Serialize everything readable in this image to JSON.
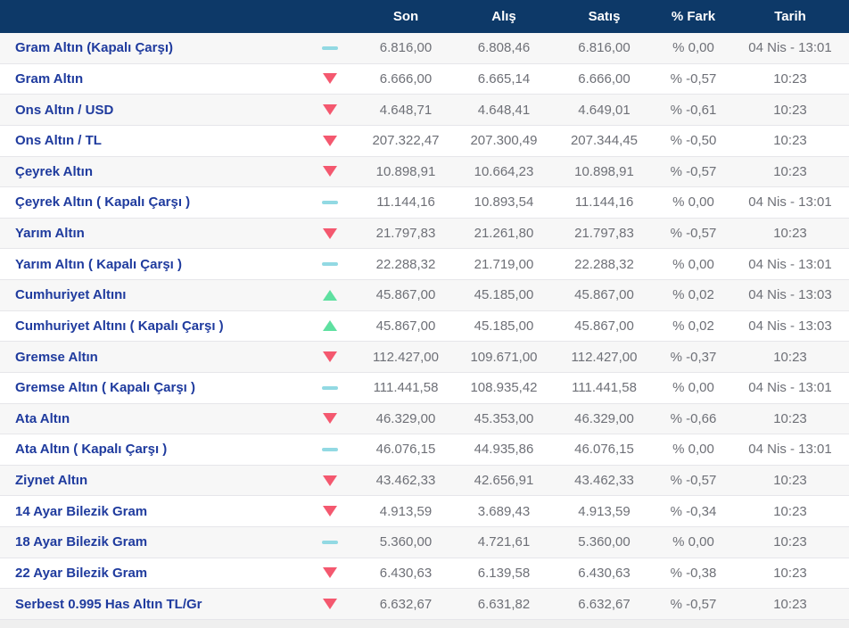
{
  "table": {
    "columns": [
      "Son",
      "Alış",
      "Satış",
      "% Fark",
      "Tarih"
    ],
    "rows": [
      {
        "name": "Gram Altın (Kapalı Çarşı)",
        "trend": "flat",
        "son": "6.816,00",
        "alis": "6.808,46",
        "satis": "6.816,00",
        "fark": "% 0,00",
        "tarih": "04 Nis - 13:01"
      },
      {
        "name": "Gram Altın",
        "trend": "down",
        "son": "6.666,00",
        "alis": "6.665,14",
        "satis": "6.666,00",
        "fark": "% -0,57",
        "tarih": "10:23"
      },
      {
        "name": "Ons Altın / USD",
        "trend": "down",
        "son": "4.648,71",
        "alis": "4.648,41",
        "satis": "4.649,01",
        "fark": "% -0,61",
        "tarih": "10:23"
      },
      {
        "name": "Ons Altın / TL",
        "trend": "down",
        "son": "207.322,47",
        "alis": "207.300,49",
        "satis": "207.344,45",
        "fark": "% -0,50",
        "tarih": "10:23"
      },
      {
        "name": "Çeyrek Altın",
        "trend": "down",
        "son": "10.898,91",
        "alis": "10.664,23",
        "satis": "10.898,91",
        "fark": "% -0,57",
        "tarih": "10:23"
      },
      {
        "name": "Çeyrek Altın ( Kapalı Çarşı )",
        "trend": "flat",
        "son": "11.144,16",
        "alis": "10.893,54",
        "satis": "11.144,16",
        "fark": "% 0,00",
        "tarih": "04 Nis - 13:01"
      },
      {
        "name": "Yarım Altın",
        "trend": "down",
        "son": "21.797,83",
        "alis": "21.261,80",
        "satis": "21.797,83",
        "fark": "% -0,57",
        "tarih": "10:23"
      },
      {
        "name": "Yarım Altın ( Kapalı Çarşı )",
        "trend": "flat",
        "son": "22.288,32",
        "alis": "21.719,00",
        "satis": "22.288,32",
        "fark": "% 0,00",
        "tarih": "04 Nis - 13:01"
      },
      {
        "name": "Cumhuriyet Altını",
        "trend": "up",
        "son": "45.867,00",
        "alis": "45.185,00",
        "satis": "45.867,00",
        "fark": "% 0,02",
        "tarih": "04 Nis - 13:03"
      },
      {
        "name": "Cumhuriyet Altını ( Kapalı Çarşı )",
        "trend": "up",
        "son": "45.867,00",
        "alis": "45.185,00",
        "satis": "45.867,00",
        "fark": "% 0,02",
        "tarih": "04 Nis - 13:03"
      },
      {
        "name": "Gremse Altın",
        "trend": "down",
        "son": "112.427,00",
        "alis": "109.671,00",
        "satis": "112.427,00",
        "fark": "% -0,37",
        "tarih": "10:23"
      },
      {
        "name": "Gremse Altın ( Kapalı Çarşı )",
        "trend": "flat",
        "son": "111.441,58",
        "alis": "108.935,42",
        "satis": "111.441,58",
        "fark": "% 0,00",
        "tarih": "04 Nis - 13:01"
      },
      {
        "name": "Ata Altın",
        "trend": "down",
        "son": "46.329,00",
        "alis": "45.353,00",
        "satis": "46.329,00",
        "fark": "% -0,66",
        "tarih": "10:23"
      },
      {
        "name": "Ata Altın ( Kapalı Çarşı )",
        "trend": "flat",
        "son": "46.076,15",
        "alis": "44.935,86",
        "satis": "46.076,15",
        "fark": "% 0,00",
        "tarih": "04 Nis - 13:01"
      },
      {
        "name": "Ziynet Altın",
        "trend": "down",
        "son": "43.462,33",
        "alis": "42.656,91",
        "satis": "43.462,33",
        "fark": "% -0,57",
        "tarih": "10:23"
      },
      {
        "name": "14 Ayar Bilezik Gram",
        "trend": "down",
        "son": "4.913,59",
        "alis": "3.689,43",
        "satis": "4.913,59",
        "fark": "% -0,34",
        "tarih": "10:23"
      },
      {
        "name": "18 Ayar Bilezik Gram",
        "trend": "flat",
        "son": "5.360,00",
        "alis": "4.721,61",
        "satis": "5.360,00",
        "fark": "% 0,00",
        "tarih": "10:23"
      },
      {
        "name": "22 Ayar Bilezik Gram",
        "trend": "down",
        "son": "6.430,63",
        "alis": "6.139,58",
        "satis": "6.430,63",
        "fark": "% -0,38",
        "tarih": "10:23"
      },
      {
        "name": "Serbest 0.995 Has Altın TL/Gr",
        "trend": "down",
        "son": "6.632,67",
        "alis": "6.631,82",
        "satis": "6.632,67",
        "fark": "% -0,57",
        "tarih": "10:23"
      }
    ]
  },
  "colors": {
    "header-bg": "#0d3968",
    "header-text": "#ffffff",
    "name-color": "#1f3b9e",
    "value-color": "#6e7077",
    "down-color": "#f4586f",
    "up-color": "#5ee0a0",
    "flat-color": "#92d9e3",
    "stripe-bg": "#f7f7f7",
    "border-color": "#e6e6ea",
    "page-bg": "#efefef"
  }
}
